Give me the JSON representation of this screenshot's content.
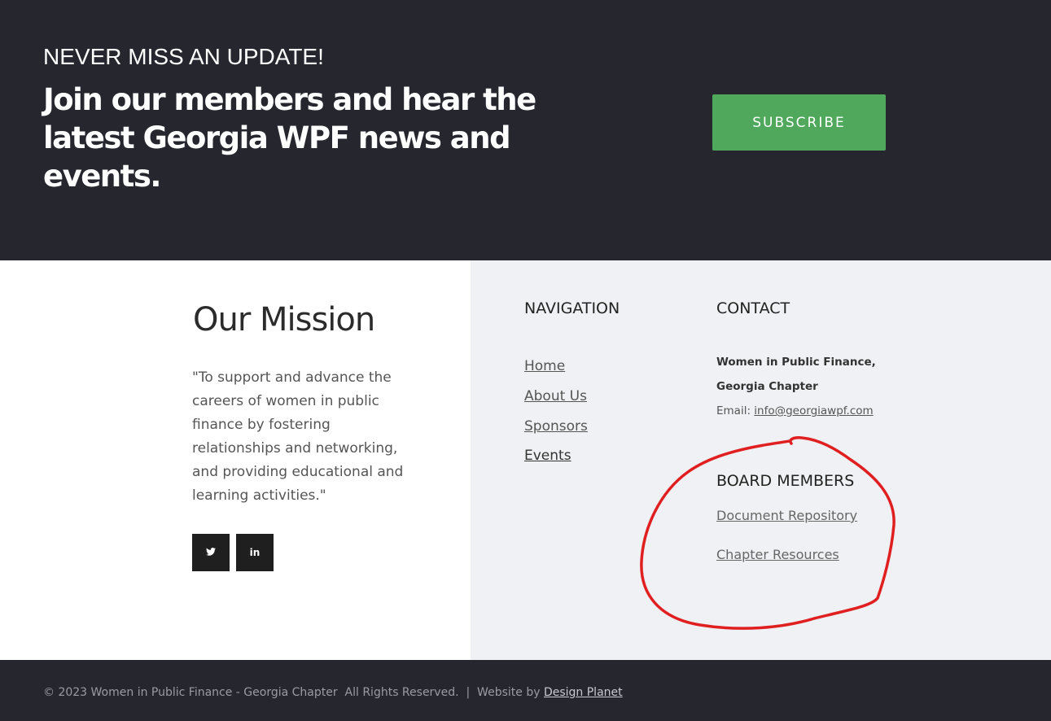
{
  "subscribe_banner": {
    "eyebrow": "NEVER MISS AN UPDATE!",
    "headline": "Join our members and hear the latest Georgia WPF news and events.",
    "button_label": "SUBSCRIBE",
    "button_color": "#4fa85b",
    "background_color": "#25262e"
  },
  "mission": {
    "title": "Our Mission",
    "text": "\"To support and advance the careers of women in public finance by fostering relationships and networking, and providing educational and learning activities.\"",
    "social": [
      {
        "icon": "twitter-icon",
        "glyph": "🐦"
      },
      {
        "icon": "linkedin-icon",
        "glyph": "in"
      }
    ]
  },
  "navigation": {
    "heading": "NAVIGATION",
    "links": [
      "Home",
      "About Us",
      "Sponsors",
      "Events"
    ]
  },
  "contact": {
    "heading": "CONTACT",
    "org_line1": "Women in Public Finance,",
    "org_line2": "Georgia Chapter",
    "email_label": "Email: ",
    "email": "info@georgiawpf.com"
  },
  "board_members": {
    "heading": "BOARD MEMBERS",
    "links": [
      "Document Repository",
      "Chapter Resources"
    ],
    "annotation_color": "#e02020"
  },
  "footer": {
    "copyright": "© 2023 Women in Public Finance - Georgia Chapter  All Rights Reserved.  |  Website by ",
    "credit_link": "Design Planet"
  }
}
